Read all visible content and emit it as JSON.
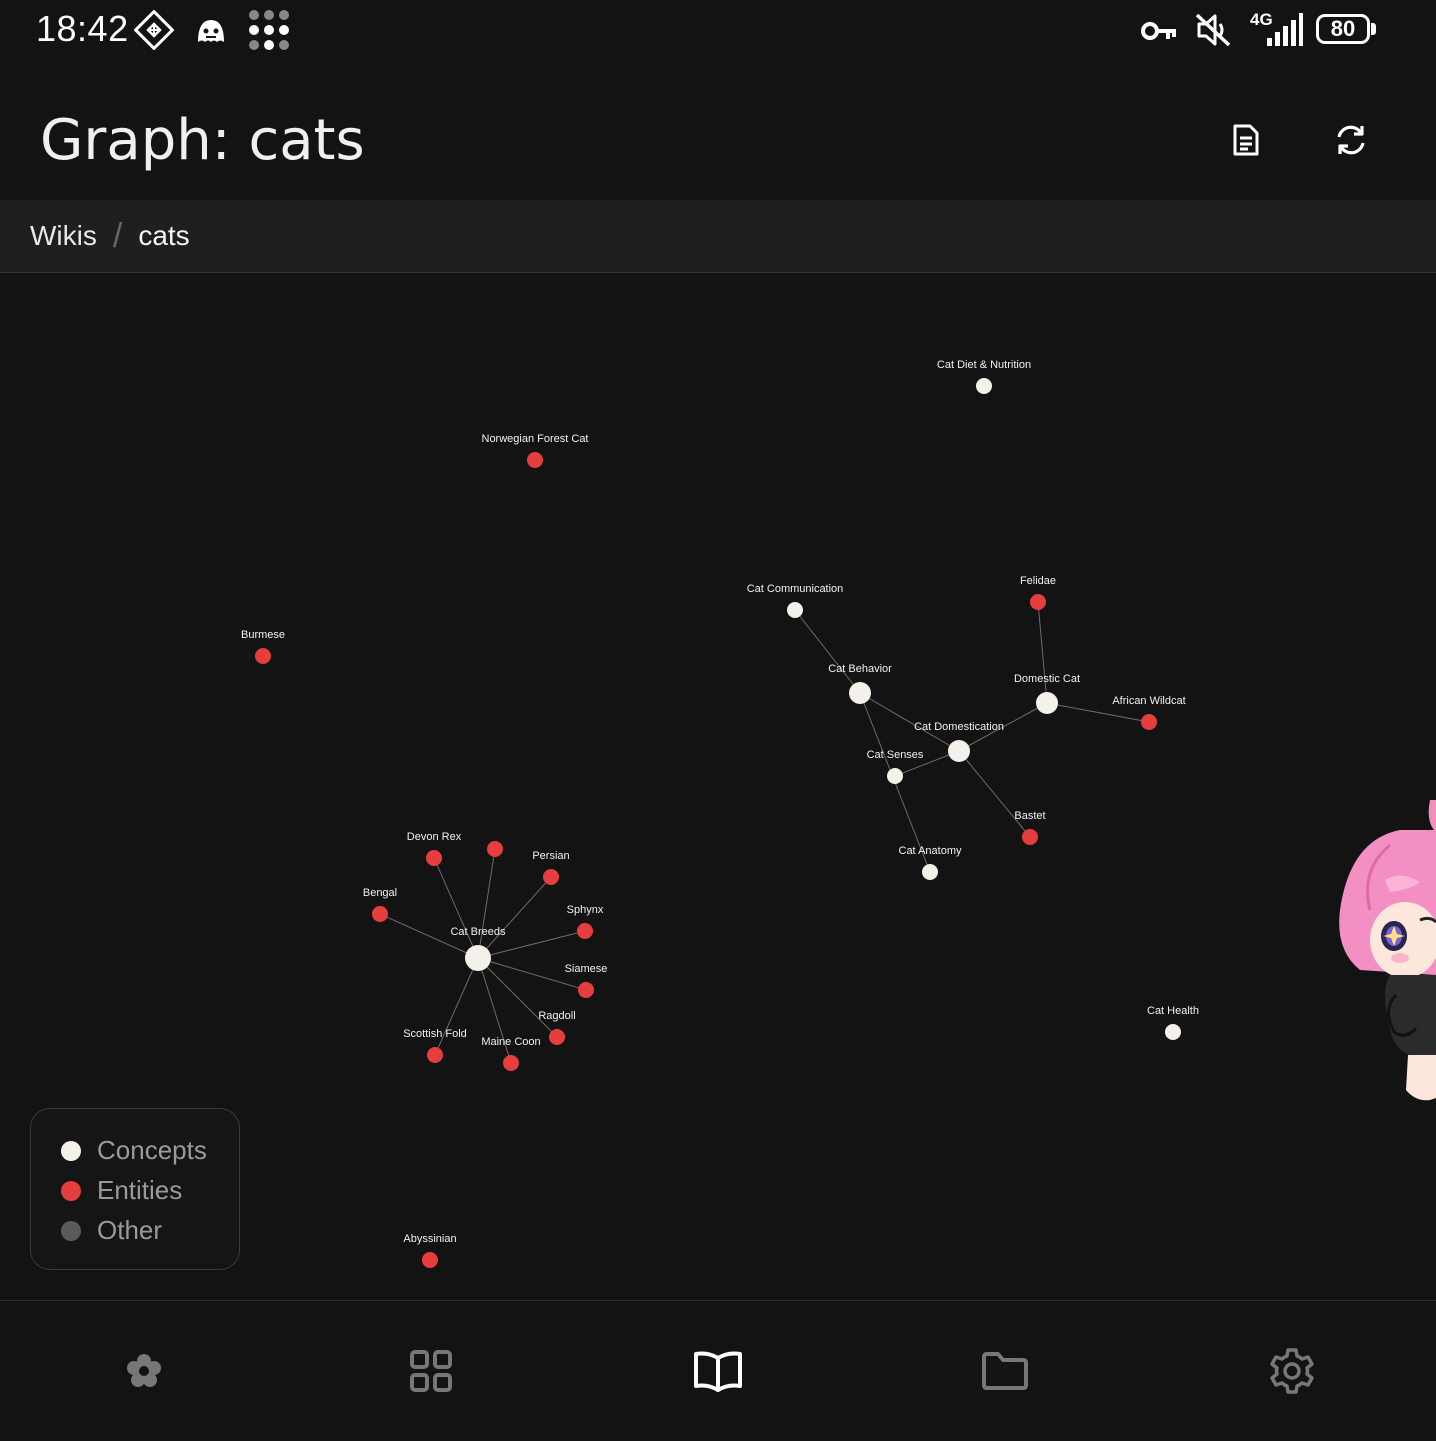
{
  "status_bar": {
    "time": "18:42",
    "network_label": "4G",
    "battery_level": "80",
    "icons": [
      "app-diamond-icon",
      "ghost-app-icon",
      "dots-grid-icon",
      "vpn-key-icon",
      "muted-speaker-icon",
      "signal-bars-icon",
      "battery-icon"
    ]
  },
  "header": {
    "title": "Graph: cats",
    "actions": [
      "document-icon",
      "refresh-icon"
    ]
  },
  "breadcrumb": {
    "root": "Wikis",
    "separator": "/",
    "current": "cats"
  },
  "colors": {
    "concept": "#f4f1ea",
    "entity": "#e63e3e",
    "other": "#5a5a5a",
    "edge": "#6b6b6b",
    "background": "#131313"
  },
  "graph": {
    "nodes": [
      {
        "id": "diet",
        "label": "Cat Diet & Nutrition",
        "kind": "concept",
        "size": "small"
      },
      {
        "id": "nfc",
        "label": "Norwegian Forest Cat",
        "kind": "entity",
        "size": "small"
      },
      {
        "id": "comm",
        "label": "Cat Communication",
        "kind": "concept",
        "size": "small"
      },
      {
        "id": "felidae",
        "label": "Felidae",
        "kind": "entity",
        "size": "small"
      },
      {
        "id": "burmese",
        "label": "Burmese",
        "kind": "entity",
        "size": "small"
      },
      {
        "id": "behavior",
        "label": "Cat Behavior",
        "kind": "concept",
        "size": "medium"
      },
      {
        "id": "domestic",
        "label": "Domestic Cat",
        "kind": "concept",
        "size": "medium"
      },
      {
        "id": "african",
        "label": "African Wildcat",
        "kind": "entity",
        "size": "small"
      },
      {
        "id": "domestication",
        "label": "Cat Domestication",
        "kind": "concept",
        "size": "medium"
      },
      {
        "id": "senses",
        "label": "Cat Senses",
        "kind": "concept",
        "size": "small"
      },
      {
        "id": "bastet",
        "label": "Bastet",
        "kind": "entity",
        "size": "small"
      },
      {
        "id": "anatomy",
        "label": "Cat Anatomy",
        "kind": "concept",
        "size": "small"
      },
      {
        "id": "devonrex",
        "label": "Devon Rex",
        "kind": "entity",
        "size": "small"
      },
      {
        "id": "unlabeled",
        "label": "",
        "kind": "entity",
        "size": "small"
      },
      {
        "id": "persian",
        "label": "Persian",
        "kind": "entity",
        "size": "small"
      },
      {
        "id": "bengal",
        "label": "Bengal",
        "kind": "entity",
        "size": "small"
      },
      {
        "id": "sphynx",
        "label": "Sphynx",
        "kind": "entity",
        "size": "small"
      },
      {
        "id": "breeds",
        "label": "Cat Breeds",
        "kind": "concept",
        "size": "large"
      },
      {
        "id": "siamese",
        "label": "Siamese",
        "kind": "entity",
        "size": "small"
      },
      {
        "id": "ragdoll",
        "label": "Ragdoll",
        "kind": "entity",
        "size": "small"
      },
      {
        "id": "scottish",
        "label": "Scottish Fold",
        "kind": "entity",
        "size": "small"
      },
      {
        "id": "mainecoon",
        "label": "Maine Coon",
        "kind": "entity",
        "size": "small"
      },
      {
        "id": "health",
        "label": "Cat Health",
        "kind": "concept",
        "size": "small"
      },
      {
        "id": "abyssinian",
        "label": "Abyssinian",
        "kind": "entity",
        "size": "small"
      }
    ],
    "edges": [
      [
        "comm",
        "behavior"
      ],
      [
        "behavior",
        "domestication"
      ],
      [
        "behavior",
        "anatomy"
      ],
      [
        "domestic",
        "domestication"
      ],
      [
        "felidae",
        "domestic"
      ],
      [
        "domestic",
        "african"
      ],
      [
        "domestication",
        "bastet"
      ],
      [
        "senses",
        "domestication"
      ],
      [
        "breeds",
        "devonrex"
      ],
      [
        "breeds",
        "unlabeled"
      ],
      [
        "breeds",
        "persian"
      ],
      [
        "breeds",
        "bengal"
      ],
      [
        "breeds",
        "sphynx"
      ],
      [
        "breeds",
        "siamese"
      ],
      [
        "breeds",
        "ragdoll"
      ],
      [
        "breeds",
        "scottish"
      ],
      [
        "breeds",
        "mainecoon"
      ]
    ]
  },
  "legend": {
    "items": [
      {
        "label": "Concepts",
        "kind": "concept"
      },
      {
        "label": "Entities",
        "kind": "entity"
      },
      {
        "label": "Other",
        "kind": "other"
      }
    ]
  },
  "bottom_nav": {
    "items": [
      "flower-icon",
      "grid-icon",
      "book-icon",
      "folder-icon",
      "settings-gear-icon"
    ],
    "active": "book-icon"
  }
}
